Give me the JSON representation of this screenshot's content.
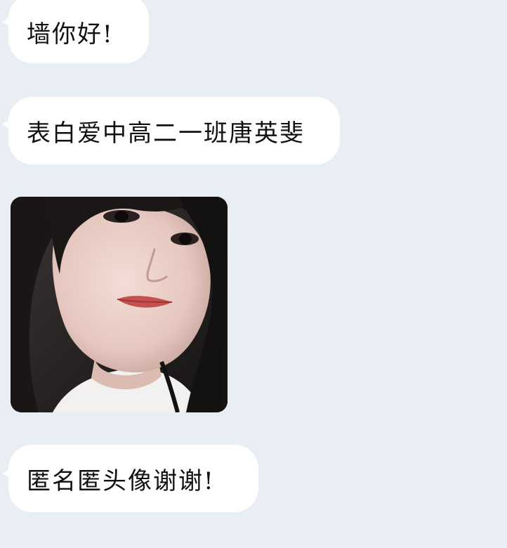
{
  "colors": {
    "background": "#e9eef5",
    "bubble": "#ffffff",
    "text": "#111111"
  },
  "messages": [
    {
      "type": "text",
      "text": "墙你好!"
    },
    {
      "type": "text",
      "text": "表白爱中高二一班唐英斐"
    },
    {
      "type": "image",
      "alt": "selfie-photo"
    },
    {
      "type": "text",
      "text": "匿名匿头像谢谢!"
    }
  ]
}
